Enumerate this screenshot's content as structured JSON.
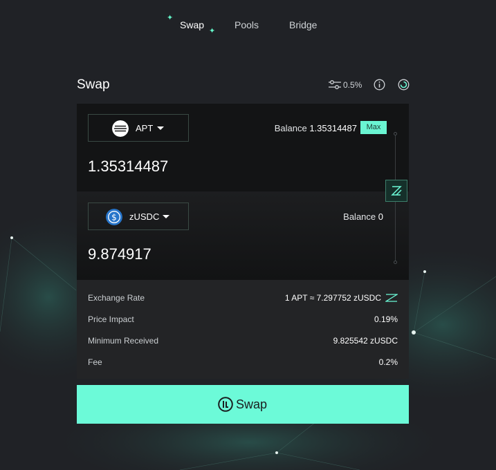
{
  "nav": {
    "items": [
      {
        "label": "Swap",
        "active": true
      },
      {
        "label": "Pools",
        "active": false
      },
      {
        "label": "Bridge",
        "active": false
      }
    ]
  },
  "page": {
    "title": "Swap"
  },
  "settings": {
    "slippage": "0.5%"
  },
  "from": {
    "token": "APT",
    "icon": "aptos-icon",
    "balance_label": "Balance",
    "balance": "1.35314487",
    "max_label": "Max",
    "amount": "1.35314487"
  },
  "to": {
    "token": "zUSDC",
    "icon": "usdc-icon",
    "balance_label": "Balance",
    "balance": "0",
    "amount": "9.874917"
  },
  "details": [
    {
      "label": "Exchange Rate",
      "value": "1 APT ≈ 7.297752 zUSDC"
    },
    {
      "label": "Price Impact",
      "value": "0.19%"
    },
    {
      "label": "Minimum Received",
      "value": "9.825542 zUSDC"
    },
    {
      "label": "Fee",
      "value": "0.2%"
    }
  ],
  "action": {
    "label": "Swap"
  },
  "colors": {
    "accent": "#6cfad8",
    "background": "#202226",
    "panel": "#131415",
    "details_bg": "#232426"
  }
}
